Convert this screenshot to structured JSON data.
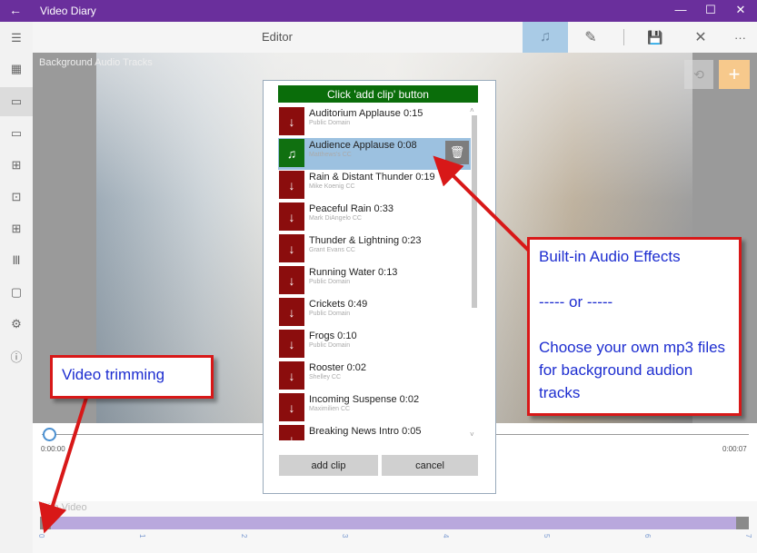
{
  "window": {
    "app_title": "Video Diary",
    "back_glyph": "←",
    "minimize_glyph": "—",
    "maximize_glyph": "☐",
    "close_glyph": "✕"
  },
  "toolbar": {
    "title": "Editor",
    "music_glyph": "♫",
    "edit_glyph": "✎",
    "save_glyph": "💾",
    "close_glyph": "✕",
    "more_glyph": "···"
  },
  "rail": [
    {
      "name": "hamburger-menu-icon",
      "glyph": "☰"
    },
    {
      "name": "calendar-icon",
      "glyph": "▦"
    },
    {
      "name": "editor-icon",
      "glyph": "▭"
    },
    {
      "name": "video-camera-icon",
      "glyph": "▭"
    },
    {
      "name": "add-document-icon",
      "glyph": "⊞"
    },
    {
      "name": "slideshow-icon",
      "glyph": "⊡"
    },
    {
      "name": "apps-icon",
      "glyph": "⊞"
    },
    {
      "name": "library-icon",
      "glyph": "Ⅲ"
    },
    {
      "name": "clipboard-icon",
      "glyph": "▢"
    },
    {
      "name": "settings-icon",
      "glyph": "⚙"
    },
    {
      "name": "info-icon",
      "glyph": "ⓘ"
    }
  ],
  "video": {
    "background_audio_label": "Background Audio Tracks",
    "restore_glyph": "⟲",
    "add_glyph": "+"
  },
  "timeline": {
    "time_start": "0:00:00",
    "time_end": "0:00:07",
    "trim_label": "Trim Video",
    "ticks": [
      "0",
      "1",
      "2",
      "3",
      "4",
      "5",
      "6",
      "7"
    ]
  },
  "dialog": {
    "header": "Click 'add clip' button",
    "download_glyph": "↓",
    "selected_glyph": "♫",
    "trash_glyph": "🗑",
    "scroll_up": "˄",
    "scroll_down": "˅",
    "clips": [
      {
        "name": "Auditorium Applause 0:15",
        "credit": "Public Domain"
      },
      {
        "name": "Audience Applause 0:08",
        "credit": "Matthews's CC"
      },
      {
        "name": "Rain & Distant Thunder 0:19",
        "credit": "Mike Koenig CC"
      },
      {
        "name": "Peaceful Rain 0:33",
        "credit": "Mark DiAngelo CC"
      },
      {
        "name": "Thunder & Lightning 0:23",
        "credit": "Grant Evans CC"
      },
      {
        "name": "Running Water 0:13",
        "credit": "Public Domain"
      },
      {
        "name": "Crickets 0:49",
        "credit": "Public Domain"
      },
      {
        "name": "Frogs 0:10",
        "credit": "Public Domain"
      },
      {
        "name": "Rooster 0:02",
        "credit": "Shelley CC"
      },
      {
        "name": "Incoming Suspense 0:02",
        "credit": "Maximilien CC"
      },
      {
        "name": "Breaking News Intro 0:05",
        "credit": ""
      }
    ],
    "add_clip_label": "add clip",
    "cancel_label": "cancel"
  },
  "callouts": {
    "audio_line1": "Built-in Audio Effects",
    "audio_line2": "----- or -----",
    "audio_line3": "Choose your own mp3 files for background audion tracks",
    "trim": "Video trimming"
  },
  "colors": {
    "titlebar": "#6a2f9c",
    "header_green": "#0a6d0a",
    "clip_icon_red": "#8b0d0d",
    "selection_blue": "#9cc1e0",
    "callout_red": "#d81818",
    "callout_text": "#1d2dd0",
    "trim_purple": "#b9a8dd"
  }
}
